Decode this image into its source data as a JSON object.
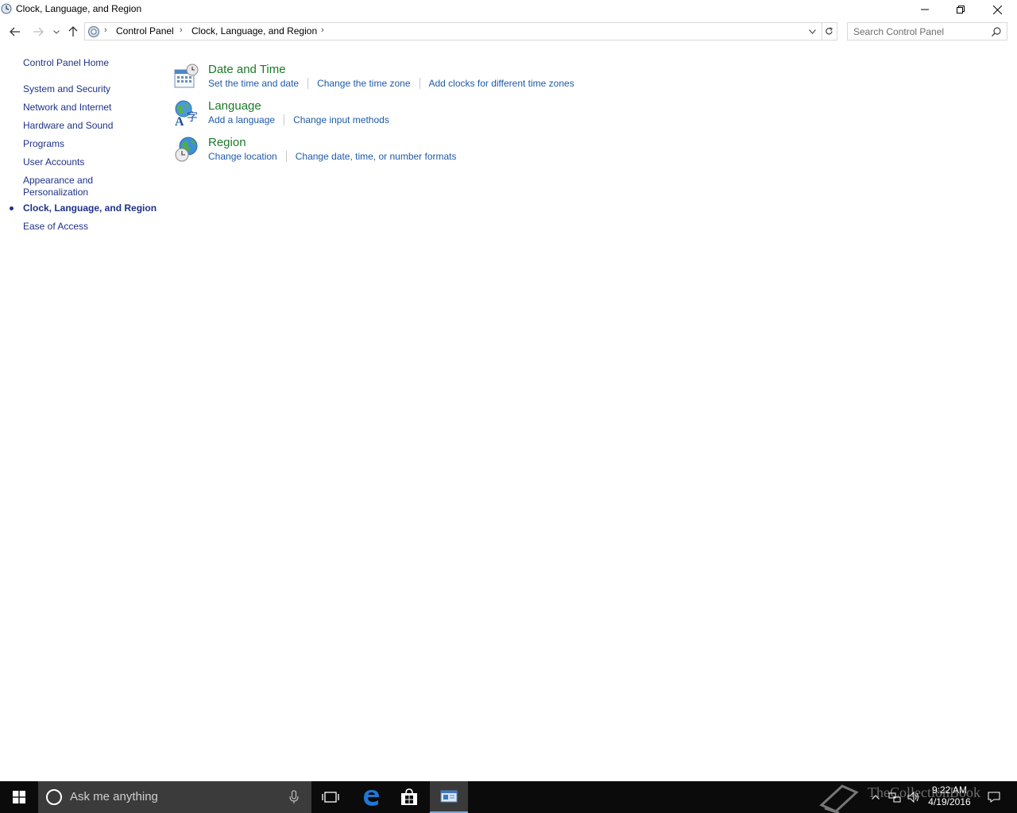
{
  "window": {
    "title": "Clock, Language, and Region"
  },
  "address": {
    "crumbs": [
      "Control Panel",
      "Clock, Language, and Region"
    ]
  },
  "search": {
    "placeholder": "Search Control Panel"
  },
  "leftnav": {
    "home": "Control Panel Home",
    "items": [
      {
        "label": "System and Security"
      },
      {
        "label": "Network and Internet"
      },
      {
        "label": "Hardware and Sound"
      },
      {
        "label": "Programs"
      },
      {
        "label": "User Accounts"
      },
      {
        "label": "Appearance and",
        "label2": "Personalization"
      },
      {
        "label": "Clock, Language, and Region",
        "current": true
      },
      {
        "label": "Ease of Access"
      }
    ]
  },
  "categories": [
    {
      "title": "Date and Time",
      "icon": "calendar-clock-icon",
      "links": [
        "Set the time and date",
        "Change the time zone",
        "Add clocks for different time zones"
      ]
    },
    {
      "title": "Language",
      "icon": "language-globe-icon",
      "links": [
        "Add a language",
        "Change input methods"
      ]
    },
    {
      "title": "Region",
      "icon": "region-globe-clock-icon",
      "links": [
        "Change location",
        "Change date, time, or number formats"
      ]
    }
  ],
  "taskbar": {
    "search_placeholder": "Ask me anything",
    "time": "9:22 AM",
    "date": "4/19/2016",
    "watermark": "TheCollectionBook"
  },
  "colors": {
    "link": "#1e5aa8",
    "nav_link": "#1e3287",
    "category_title": "#1b7a28",
    "taskbar": "#0b0b0b"
  }
}
